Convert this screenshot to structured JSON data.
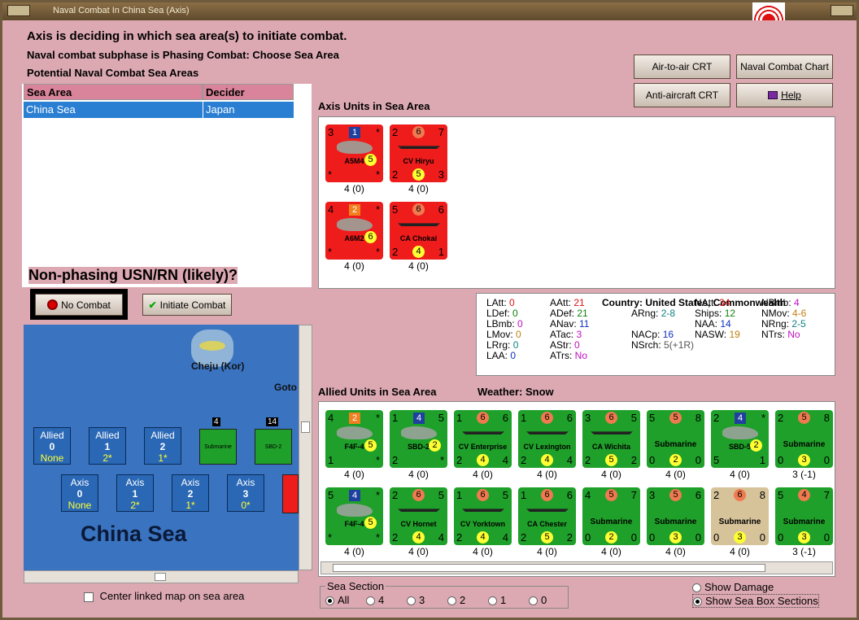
{
  "window": {
    "title": "Naval Combat In China Sea (Axis)"
  },
  "header": {
    "line1": "Axis is deciding in which sea area(s) to initiate combat.",
    "line2": "Naval combat subphase is Phasing Combat: Choose Sea Area",
    "line3": "Potential Naval Combat Sea Areas"
  },
  "buttons": {
    "air_to_air": "Air-to-air CRT",
    "naval_chart": "Naval Combat Chart",
    "anti_aircraft": "Anti-aircraft CRT",
    "help": "Help",
    "no_combat": "No Combat",
    "initiate_combat": "Initiate Combat"
  },
  "sea_table": {
    "headers": [
      "Sea Area",
      "Decider"
    ],
    "rows": [
      [
        "China Sea",
        "Japan"
      ]
    ]
  },
  "question": "Non-phasing USN/RN (likely)?",
  "axis_section": "Axis Units in Sea Area",
  "allied_section": "Allied Units in Sea Area",
  "weather": "Weather:  Snow",
  "axis_units": [
    {
      "type": "air",
      "tl": "3",
      "tc": "1",
      "tr": "*",
      "bl": "*",
      "bc": "5",
      "br": "*",
      "name": "A5M4",
      "label": "4 (0)"
    },
    {
      "type": "ship",
      "tl": "2",
      "tc": "6",
      "tr": "7",
      "bl": "2",
      "bc": "5",
      "br": "3",
      "name": "CV Hiryu",
      "label": "4 (0)"
    },
    {
      "type": "air",
      "tl": "4",
      "tc": "2",
      "tr": "*",
      "bl": "*",
      "bc": "6",
      "br": "*",
      "name": "A6M2",
      "label": "4 (0)"
    },
    {
      "type": "ship",
      "tl": "5",
      "tc": "6",
      "tr": "6",
      "bl": "2",
      "bc": "4",
      "br": "1",
      "name": "CA Chokai",
      "label": "4 (0)"
    }
  ],
  "allied_units": [
    {
      "color": "green",
      "type": "air",
      "tl": "4",
      "tc": "2",
      "tr": "*",
      "bl": "1",
      "bc": "5",
      "br": "*",
      "name": "F4F-4",
      "label": "4 (0)"
    },
    {
      "color": "green",
      "type": "air",
      "tl": "1",
      "tc": "4",
      "tr": "5",
      "bl": "2",
      "bc": "2",
      "br": "*",
      "name": "SBD-2",
      "label": "4 (0)"
    },
    {
      "color": "green",
      "type": "ship",
      "tl": "1",
      "tc": "6",
      "tr": "6",
      "bl": "2",
      "bc": "4",
      "br": "4",
      "name": "CV Enterprise",
      "label": "4 (0)"
    },
    {
      "color": "green",
      "type": "ship",
      "tl": "1",
      "tc": "6",
      "tr": "6",
      "bl": "2",
      "bc": "4",
      "br": "4",
      "name": "CV Lexington",
      "label": "4 (0)"
    },
    {
      "color": "green",
      "type": "ship",
      "tl": "3",
      "tc": "6",
      "tr": "5",
      "bl": "2",
      "bc": "5",
      "br": "2",
      "name": "CA Wichita",
      "label": "4 (0)"
    },
    {
      "color": "green",
      "type": "sub",
      "tl": "5",
      "tc": "5",
      "tr": "8",
      "bl": "0",
      "bc": "2",
      "br": "0",
      "name": "Submarine",
      "label": "4 (0)"
    },
    {
      "color": "green",
      "type": "air",
      "tl": "2",
      "tc": "4",
      "tr": "*",
      "bl": "5",
      "bc": "2",
      "br": "1",
      "name": "SBD-5",
      "label": "4 (0)"
    },
    {
      "color": "green",
      "type": "sub",
      "tl": "2",
      "tc": "5",
      "tr": "8",
      "bl": "0",
      "bc": "3",
      "br": "0",
      "name": "Submarine",
      "label": "3 (-1)"
    },
    {
      "color": "green",
      "type": "air",
      "tl": "5",
      "tc": "4",
      "tr": "*",
      "bl": "*",
      "bc": "5",
      "br": "*",
      "name": "F4F-4",
      "label": "4 (0)"
    },
    {
      "color": "green",
      "type": "ship",
      "tl": "2",
      "tc": "6",
      "tr": "5",
      "bl": "2",
      "bc": "4",
      "br": "4",
      "name": "CV Hornet",
      "label": "4 (0)"
    },
    {
      "color": "green",
      "type": "ship",
      "tl": "1",
      "tc": "6",
      "tr": "5",
      "bl": "2",
      "bc": "4",
      "br": "4",
      "name": "CV Yorktown",
      "label": "4 (0)"
    },
    {
      "color": "green",
      "type": "ship",
      "tl": "1",
      "tc": "6",
      "tr": "6",
      "bl": "2",
      "bc": "5",
      "br": "2",
      "name": "CA Chester",
      "label": "4 (0)"
    },
    {
      "color": "green",
      "type": "sub",
      "tl": "4",
      "tc": "5",
      "tr": "7",
      "bl": "0",
      "bc": "2",
      "br": "0",
      "name": "Submarine",
      "label": "4 (0)"
    },
    {
      "color": "green",
      "type": "sub",
      "tl": "3",
      "tc": "5",
      "tr": "6",
      "bl": "0",
      "bc": "3",
      "br": "0",
      "name": "Submarine",
      "label": "4 (0)"
    },
    {
      "color": "tan",
      "type": "sub",
      "tl": "2",
      "tc": "6",
      "tr": "8",
      "bl": "0",
      "bc": "3",
      "br": "0",
      "name": "Submarine",
      "label": "4 (0)"
    },
    {
      "color": "green",
      "type": "sub",
      "tl": "5",
      "tc": "4",
      "tr": "7",
      "bl": "0",
      "bc": "3",
      "br": "0",
      "name": "Submarine",
      "label": "3 (-1)"
    }
  ],
  "stats": {
    "country": "Country: United States, Commonwealth",
    "rows": [
      [
        [
          "LAtt:",
          "0",
          "c-red"
        ],
        [
          "AAtt:",
          "21",
          "c-red"
        ],
        null,
        [
          "NAtt:",
          "34",
          "c-red"
        ],
        [
          "NBmb:",
          "4",
          "c-mag"
        ]
      ],
      [
        [
          "LDef:",
          "0",
          "c-green"
        ],
        [
          "ADef:",
          "21",
          "c-green"
        ],
        [
          "ARng:",
          "2-8",
          "c-teal"
        ],
        [
          "Ships:",
          "12",
          "c-green"
        ],
        [
          "NMov:",
          "4-6",
          "c-org"
        ]
      ],
      [
        [
          "LBmb:",
          "0",
          "c-mag"
        ],
        [
          "ANav:",
          "11",
          "c-blue"
        ],
        null,
        [
          "NAA:",
          "14",
          "c-blue"
        ],
        [
          "NRng:",
          "2-5",
          "c-teal"
        ]
      ],
      [
        [
          "LMov:",
          "0",
          "c-org"
        ],
        [
          "ATac:",
          "3",
          "c-mag"
        ],
        [
          "NACp:",
          "16",
          "c-blue"
        ],
        [
          "NASW:",
          "19",
          "c-org"
        ],
        [
          "NTrs:",
          "No",
          "c-mag"
        ]
      ],
      [
        [
          "LRrg:",
          "0",
          "c-teal"
        ],
        [
          "AStr:",
          "0",
          "c-mag"
        ],
        [
          "NSrch:",
          "5(+1R)",
          "c-gray"
        ],
        null,
        null
      ],
      [
        [
          "LAA:",
          "0",
          "c-blue"
        ],
        [
          "ATrs:",
          "No",
          "c-mag"
        ],
        null,
        null,
        null
      ]
    ]
  },
  "map": {
    "name": "China Sea",
    "island": "Cheju (Kor)",
    "goto": "Goto",
    "allied_boxes": [
      [
        "Allied",
        "0",
        "None"
      ],
      [
        "Allied",
        "1",
        "2*"
      ],
      [
        "Allied",
        "2",
        "1*"
      ]
    ],
    "axis_boxes": [
      [
        "Axis",
        "0",
        "None"
      ],
      [
        "Axis",
        "1",
        "2*"
      ],
      [
        "Axis",
        "2",
        "1*"
      ],
      [
        "Axis",
        "3",
        "0*"
      ]
    ],
    "stack_counts": [
      "4",
      "14"
    ],
    "stack_names": [
      "Submarine",
      "SBD-2"
    ]
  },
  "footer": {
    "center_map": "Center linked map on sea area",
    "sea_section": "Sea Section",
    "sections": [
      "All",
      "4",
      "3",
      "2",
      "1",
      "0"
    ],
    "show_damage": "Show Damage",
    "show_boxes": "Show Sea Box Sections"
  }
}
